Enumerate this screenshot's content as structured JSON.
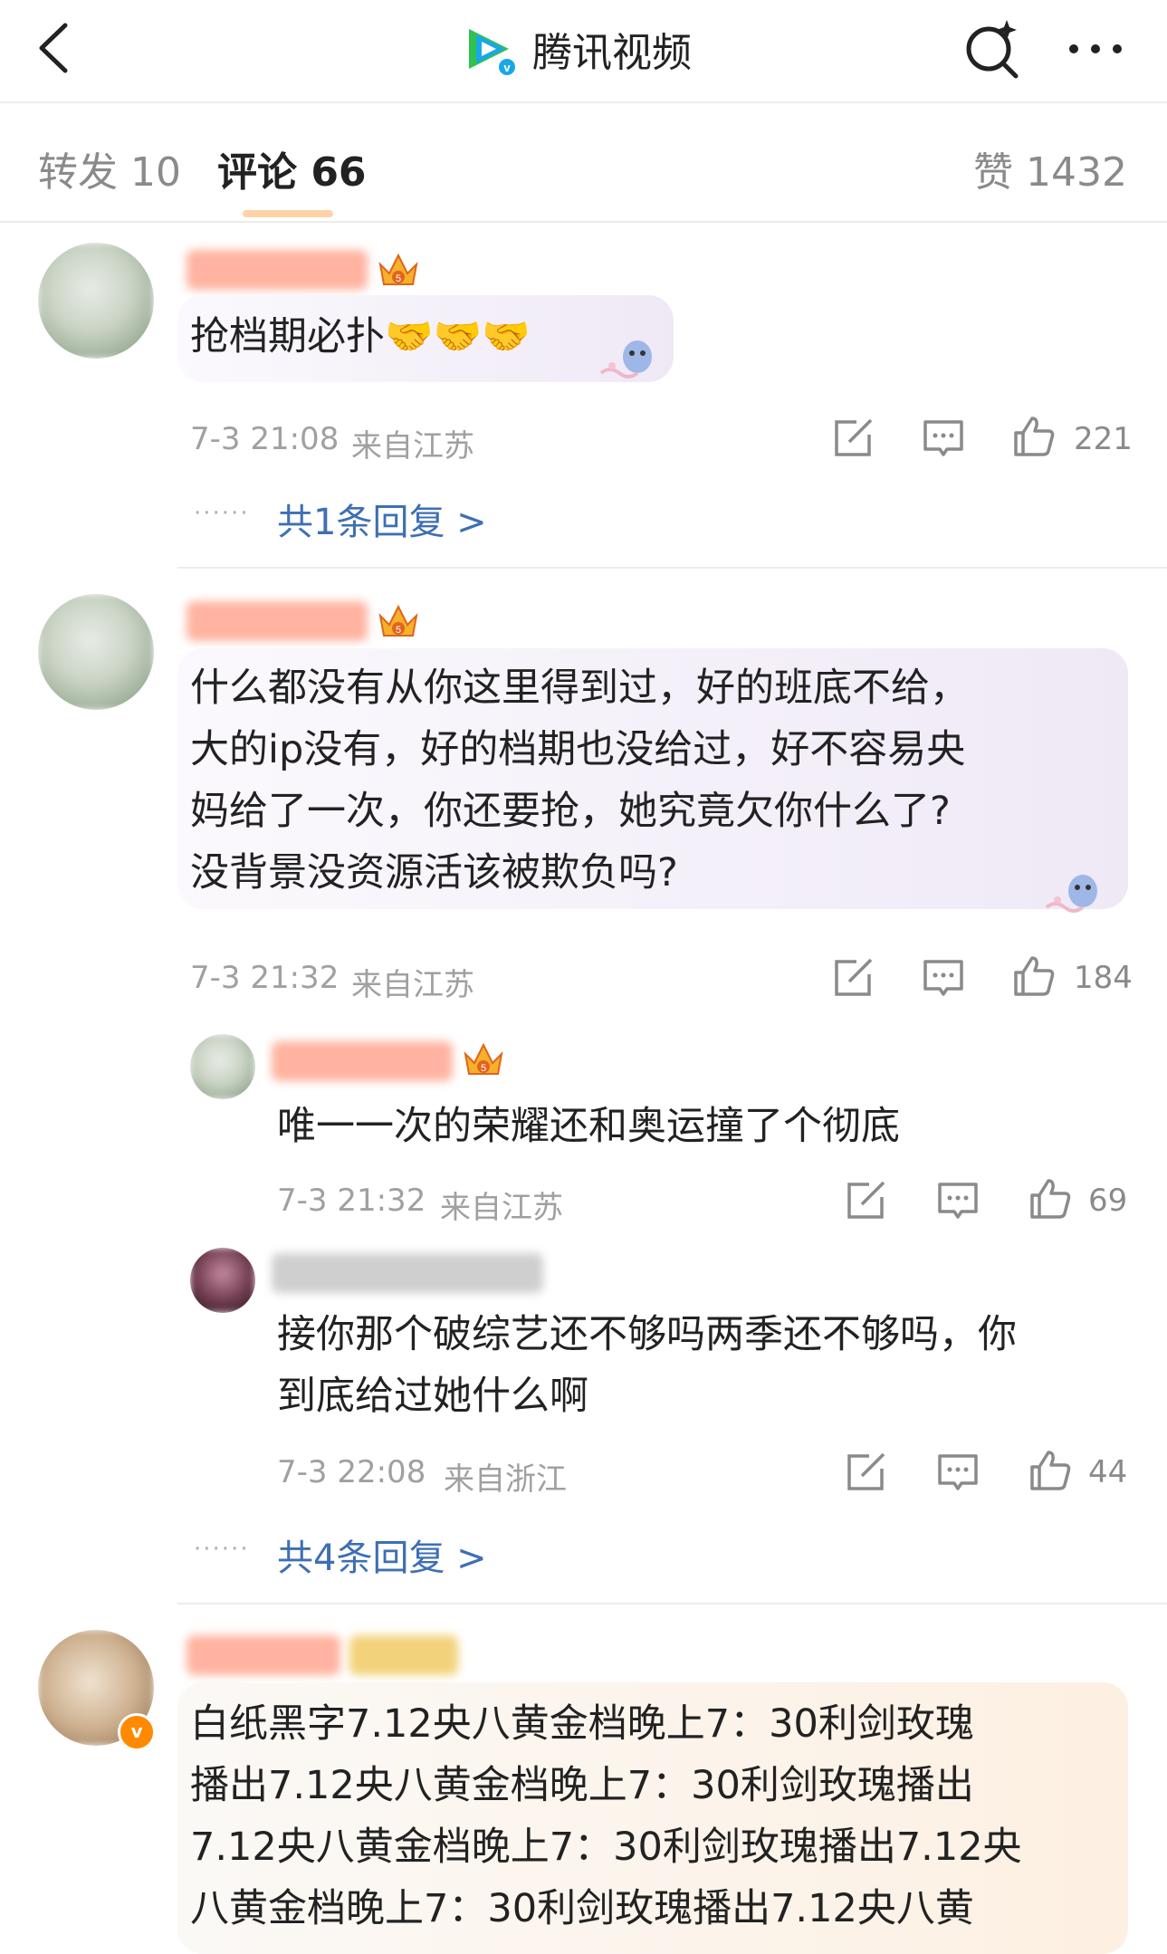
{
  "header": {
    "app_name": "腾讯视频",
    "back_icon": "chevron-left-icon",
    "search_icon": "search-sparkle-icon",
    "more_icon": "more-horizontal-icon",
    "brand_colors": {
      "green": "#2ec24f",
      "blue": "#1aa7e8",
      "orange": "#ff8a00"
    }
  },
  "tabs": {
    "forward": "转发 10",
    "comments": "评论 66",
    "likes": "赞 1432"
  },
  "comments": [
    {
      "text": "抢档期必扑🤝🤝🤝",
      "time": "7-3 21:08",
      "location": "来自江苏",
      "likes": "221",
      "reply_link": "共1条回复 >",
      "dots": "······"
    },
    {
      "text_lines": [
        "什么都没有从你这里得到过，好的班底不给，",
        "大的ip没有，好的档期也没给过，好不容易央",
        "妈给了一次，你还要抢，她究竟欠你什么了?",
        "没背景没资源活该被欺负吗?"
      ],
      "time": "7-3 21:32",
      "location": "来自江苏",
      "likes": "184",
      "replies": [
        {
          "text": "唯一一次的荣耀还和奥运撞了个彻底",
          "time": "7-3 21:32",
          "location": "来自江苏",
          "likes": "69"
        },
        {
          "text_lines": [
            "接你那个破综艺还不够吗两季还不够吗，你",
            "到底给过她什么啊"
          ],
          "time": "7-3 22:08",
          "location": "来自浙江",
          "likes": "44"
        }
      ],
      "reply_link": "共4条回复 >",
      "dots": "······"
    },
    {
      "text_lines": [
        "白纸黑字7.12央八黄金档晚上7：30利剑玫瑰",
        "播出7.12央八黄金档晚上7：30利剑玫瑰播出",
        "7.12央八黄金档晚上7：30利剑玫瑰播出7.12央",
        "八黄金档晚上7：30利剑玫瑰播出7.12央八黄"
      ],
      "verified_badge": "v"
    }
  ],
  "accent_colors": {
    "link": "#3e6fb3",
    "meta": "#a0a0a0",
    "bubble_purple": "#f3eef8",
    "bubble_orange": "#fdf3e8"
  }
}
